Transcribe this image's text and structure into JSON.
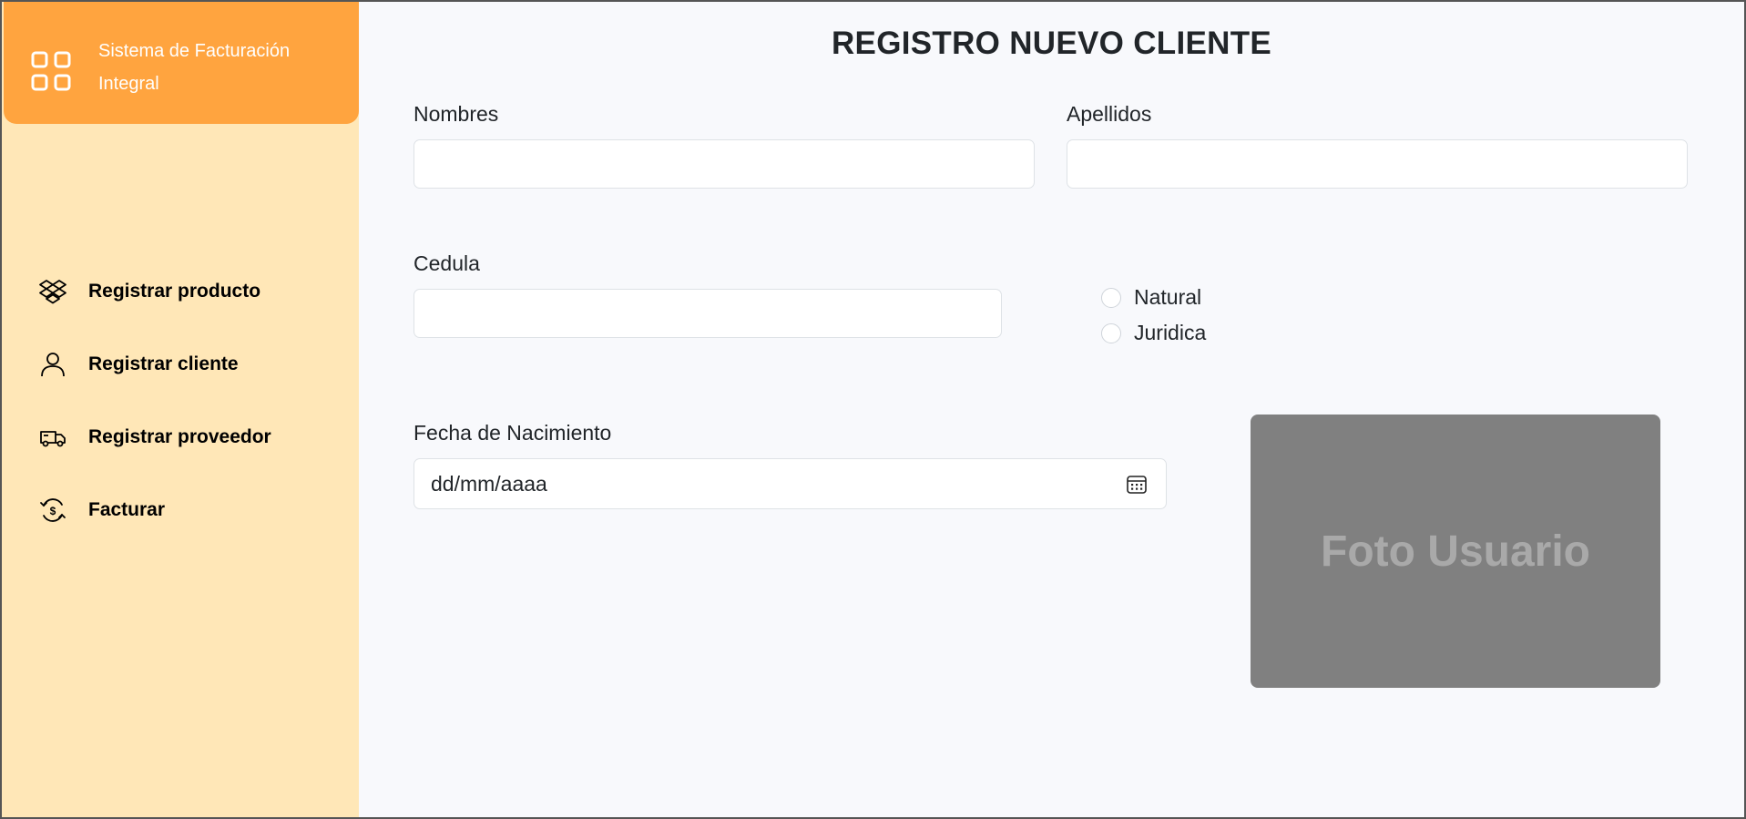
{
  "app": {
    "brand_title": "Sistema de Facturación Integral",
    "brand_icon": "grid-icon"
  },
  "sidebar": {
    "items": [
      {
        "label": "Registrar producto",
        "icon": "dropbox-icon"
      },
      {
        "label": "Registrar cliente",
        "icon": "user-icon"
      },
      {
        "label": "Registrar proveedor",
        "icon": "truck-icon"
      },
      {
        "label": "Facturar",
        "icon": "cash-cycle-icon"
      }
    ]
  },
  "form": {
    "title": "REGISTRO NUEVO CLIENTE",
    "nombres_label": "Nombres",
    "nombres_value": "",
    "apellidos_label": "Apellidos",
    "apellidos_value": "",
    "cedula_label": "Cedula",
    "cedula_value": "",
    "person_type_options": [
      "Natural",
      "Juridica"
    ],
    "fecha_label": "Fecha de Nacimiento",
    "fecha_placeholder": "dd/mm/aaaa",
    "photo_label": "Foto Usuario"
  },
  "colors": {
    "brand": "#ffa43f",
    "sidebar_bg": "#ffe7b7",
    "main_bg": "#f8f9fc",
    "photo_bg": "#808080"
  }
}
